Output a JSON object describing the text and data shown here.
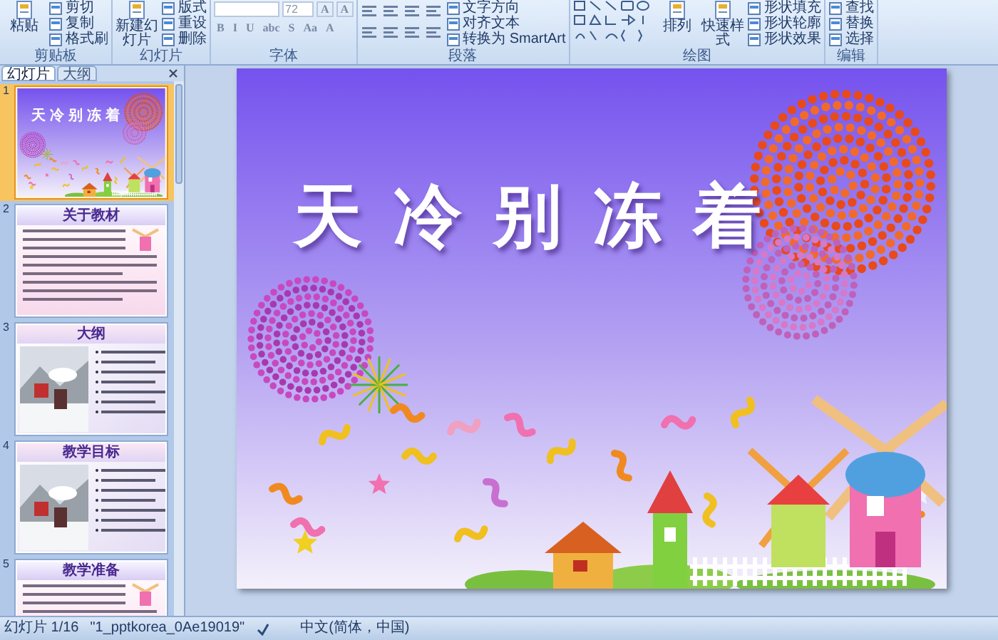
{
  "ribbon": {
    "groups": [
      {
        "label": "剪贴板",
        "items": [
          {
            "kind": "large",
            "label": "粘贴"
          },
          {
            "kind": "small",
            "label": "剪切"
          },
          {
            "kind": "small",
            "label": "复制"
          },
          {
            "kind": "small",
            "label": "格式刷"
          }
        ]
      },
      {
        "label": "幻灯片",
        "items": [
          {
            "kind": "large",
            "label": "新建幻灯片"
          },
          {
            "kind": "small",
            "label": "版式"
          },
          {
            "kind": "small",
            "label": "重设"
          },
          {
            "kind": "small",
            "label": "删除"
          }
        ]
      },
      {
        "label": "字体",
        "items": [
          {
            "kind": "font",
            "size": "72",
            "row1": [
              "A",
              "A"
            ],
            "row2": [
              "B",
              "I",
              "U",
              "abc",
              "S",
              "Aa",
              "A"
            ]
          }
        ]
      },
      {
        "label": "段落",
        "items": [
          {
            "kind": "paragraph_icons"
          },
          {
            "kind": "small",
            "label": "文字方向"
          },
          {
            "kind": "small",
            "label": "对齐文本"
          },
          {
            "kind": "small",
            "label": "转换为 SmartArt"
          }
        ]
      },
      {
        "label": "绘图",
        "items": [
          {
            "kind": "shapes"
          },
          {
            "kind": "large",
            "label": "排列"
          },
          {
            "kind": "large",
            "label": "快速样式"
          },
          {
            "kind": "small",
            "label": "形状填充"
          },
          {
            "kind": "small",
            "label": "形状轮廓"
          },
          {
            "kind": "small",
            "label": "形状效果"
          }
        ]
      },
      {
        "label": "编辑",
        "items": [
          {
            "kind": "small",
            "label": "查找"
          },
          {
            "kind": "small",
            "label": "替换"
          },
          {
            "kind": "small",
            "label": "选择"
          }
        ]
      }
    ]
  },
  "panel_tabs": [
    {
      "label": "幻灯片",
      "selected": true
    },
    {
      "label": "大纲",
      "selected": false
    }
  ],
  "slides": [
    {
      "number": "1",
      "selected": true,
      "kind": "title",
      "title": "天冷别冻着"
    },
    {
      "number": "2",
      "selected": false,
      "kind": "text",
      "title": "关于教材"
    },
    {
      "number": "3",
      "selected": false,
      "kind": "photo_list",
      "title": "大纲"
    },
    {
      "number": "4",
      "selected": false,
      "kind": "photo_list",
      "title": "教学目标"
    },
    {
      "number": "5",
      "selected": false,
      "kind": "text",
      "title": "教学准备"
    }
  ],
  "slide": {
    "title": "天冷别冻着"
  },
  "status_bar": [
    "幻灯片 1/16",
    "\"1_pptkorea_0Ae19019\"",
    "中文(简体，中国)"
  ]
}
